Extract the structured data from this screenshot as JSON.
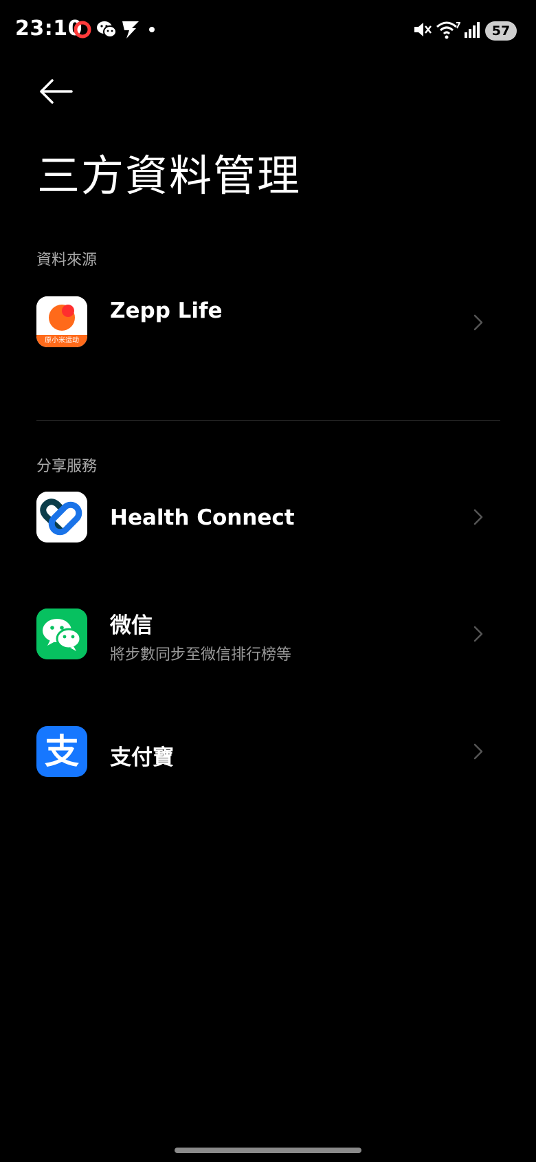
{
  "status_bar": {
    "time": "23:10",
    "left_icons": [
      "opera-icon",
      "wechat-icon",
      "notification-icon",
      "dot-icon"
    ],
    "right_icons": [
      "mute-icon",
      "wifi-icon",
      "signal-icon"
    ],
    "battery": "57"
  },
  "header": {
    "back_icon": "back-arrow-icon",
    "title": "三方資料管理"
  },
  "sections": {
    "data_source": {
      "header": "資料來源",
      "items": [
        {
          "title": "Zepp Life",
          "icon": "zepp-life-icon",
          "icon_label": "原小米运动"
        }
      ]
    },
    "share_services": {
      "header": "分享服務",
      "items": [
        {
          "title": "Health Connect",
          "icon": "health-connect-icon"
        },
        {
          "title": "微信",
          "subtitle": "將步數同步至微信排行榜等",
          "icon": "wechat-app-icon"
        },
        {
          "title": "支付寶",
          "icon": "alipay-icon",
          "icon_glyph": "支"
        }
      ]
    }
  },
  "colors": {
    "background": "#000000",
    "zepp_orange": "#FF6A1A",
    "wechat_green": "#07C160",
    "alipay_blue": "#1677FF",
    "health_connect_blue": "#1A73E8"
  }
}
